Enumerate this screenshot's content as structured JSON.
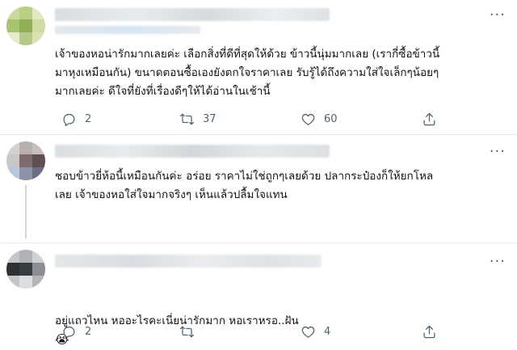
{
  "tweets": [
    {
      "text": "เจ้าของหอน่ารักมากเลยค่ะ เลือกสิ่งที่ดีที่สุดให้ด้วย ข้าวนี้นุ่มมากเลย (เรากี่ซื้อข้าวนี้\nมาหุงเหมือนกัน) ขนาดตอนซื้อเองยังตกใจราคาเลย รับรู้ได้ถึงความใส่ใจเล็กๆน้อยๆ\nมากเลยค่ะ ดีใจที่ยังที่เรื่องดีๆให้ได้อ่านในเช้านี้",
      "replies": "2",
      "retweets": "37",
      "likes": "60"
    },
    {
      "text": "ชอบข้าวยี่ห้อนี้เหมือนกันค่ะ อร่อย ราคาไม่ใช่ถูกๆเลยด้วย ปลากระป๋องก็ให้ยกโหล\nเลย เจ้าของหอใส่ใจมากจริงๆ เห็นแล้วปลื้มใจแทน"
    },
    {
      "text": "อยู่แถวไหน หออะไรคะเนี่ยน่ารักมาก หอเราหรอ..ฝัน",
      "emoji": "😭",
      "replies": "2",
      "retweets": "",
      "likes": "4"
    }
  ],
  "more_label": "···",
  "icons": {
    "reply": "reply-icon",
    "retweet": "retweet-icon",
    "like": "heart-icon",
    "share": "share-icon",
    "more": "more-icon"
  },
  "colors": {
    "icon": "#536471",
    "divider": "#e6ecf0",
    "thread_line": "#cfd9de"
  }
}
